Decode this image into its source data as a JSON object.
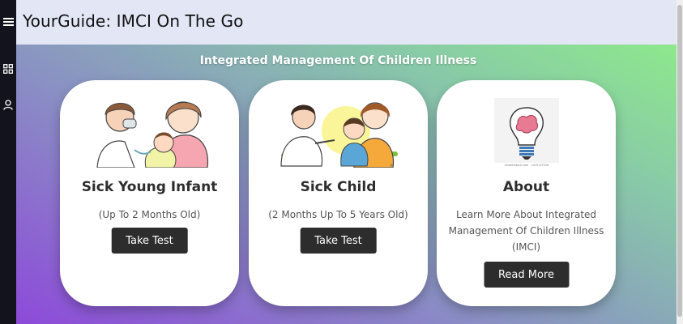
{
  "app": {
    "title": "YourGuide: IMCI On The Go"
  },
  "sidebar": {
    "icons": [
      {
        "name": "menu-icon"
      },
      {
        "name": "grid-icon"
      },
      {
        "name": "user-icon"
      }
    ]
  },
  "main": {
    "headline": "Integrated Management Of Children Illness",
    "cards": [
      {
        "title": "Sick Young Infant",
        "subtitle": "(Up To 2 Months Old)",
        "button": "Take Test",
        "image": "infant-with-doctor-illustration"
      },
      {
        "title": "Sick Child",
        "subtitle": "(2 Months Up To 5 Years Old)",
        "button": "Take Test",
        "image": "child-with-doctor-illustration"
      },
      {
        "title": "About",
        "subtitle": "Learn More About Integrated Management Of Children Illness (IMCI)",
        "button": "Read More",
        "image": "brain-lightbulb-illustration",
        "image_caption": "shutterstock.com · 1475137526"
      }
    ]
  },
  "colors": {
    "sidebar": "#13131e",
    "topbar": "#e2e6f5",
    "gradient_start": "#8d4ad9",
    "gradient_end": "#8ee88c",
    "button": "#2d2d2d"
  }
}
